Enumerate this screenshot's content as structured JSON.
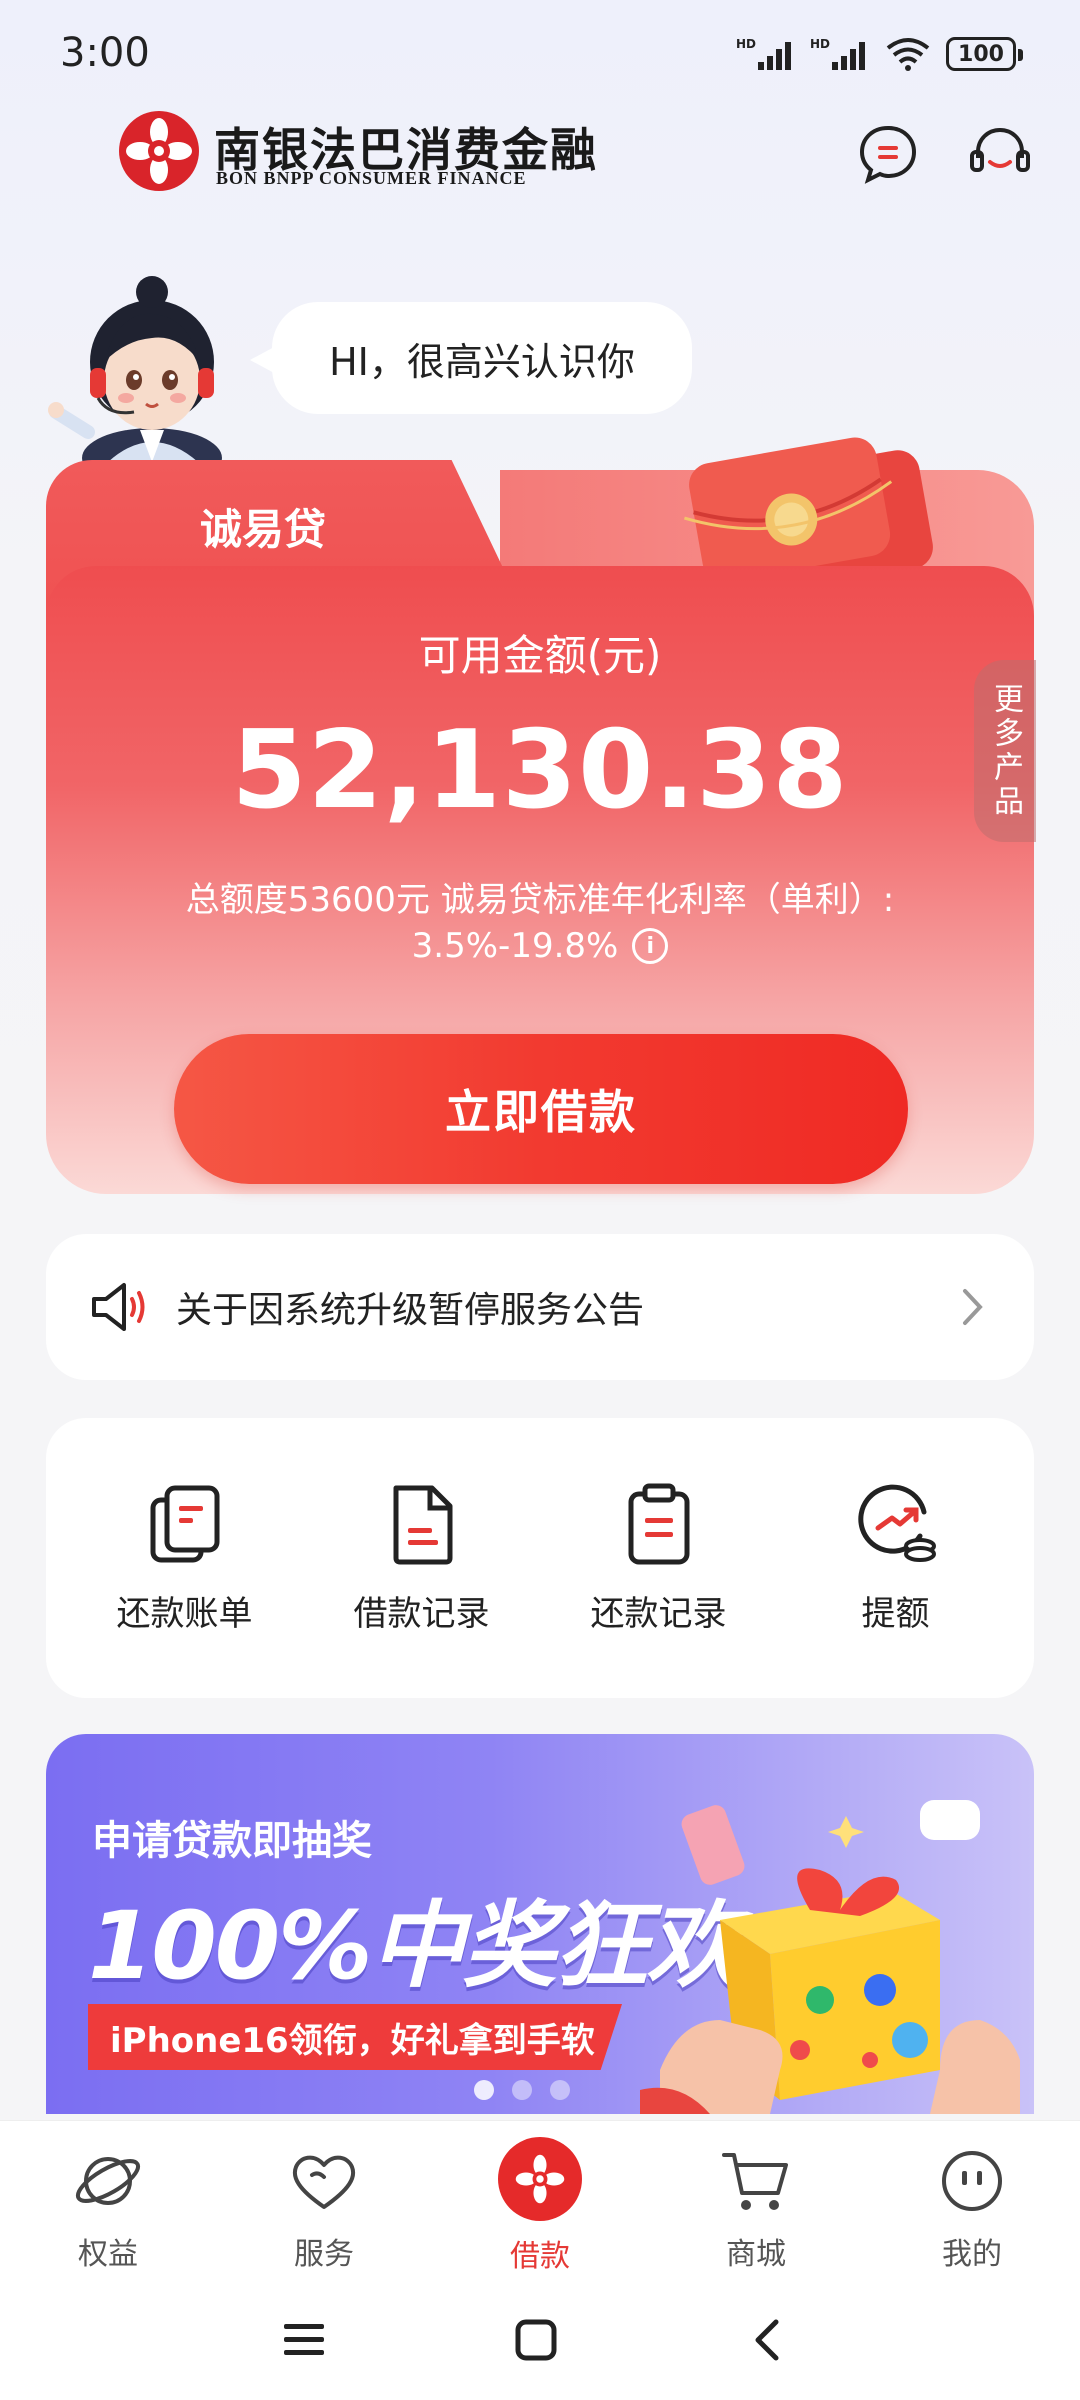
{
  "status_bar": {
    "time": "3:00",
    "battery": "100",
    "signal_label": "HD"
  },
  "header": {
    "brand_cn": "南银法巴消费金融",
    "brand_en": "BON BNPP CONSUMER FINANCE",
    "message_icon": "chat-icon",
    "service_icon": "headset-icon"
  },
  "greeting": {
    "text": "HI，很高兴认识你"
  },
  "loan_card": {
    "product_name": "诚易贷",
    "available_label": "可用金额(元)",
    "available_amount": "52,130.38",
    "rate_line1": "总额度53600元 诚易贷标准年化利率（单利）:",
    "rate_line2": "3.5%-19.8%",
    "borrow_button": "立即借款",
    "more_products": "更多产品"
  },
  "notice": {
    "text": "关于因系统升级暂停服务公告"
  },
  "quick_actions": [
    {
      "label": "还款账单",
      "icon": "bill-icon"
    },
    {
      "label": "借款记录",
      "icon": "document-icon"
    },
    {
      "label": "还款记录",
      "icon": "clipboard-icon"
    },
    {
      "label": "提额",
      "icon": "limit-up-icon"
    }
  ],
  "banner": {
    "subtitle": "申请贷款即抽奖",
    "headline": "100%中奖狂欢",
    "ribbon": "iPhone16领衔，好礼拿到手软"
  },
  "bottom_nav": [
    {
      "label": "权益",
      "icon": "planet-icon",
      "active": false
    },
    {
      "label": "服务",
      "icon": "heart-icon",
      "active": false
    },
    {
      "label": "借款",
      "icon": "flower-logo-icon",
      "active": true
    },
    {
      "label": "商城",
      "icon": "cart-icon",
      "active": false
    },
    {
      "label": "我的",
      "icon": "smiley-icon",
      "active": false
    }
  ],
  "colors": {
    "brand_red": "#e52a2a",
    "card_red": "#ef4d4f",
    "banner_purple": "#7b6ef2"
  }
}
